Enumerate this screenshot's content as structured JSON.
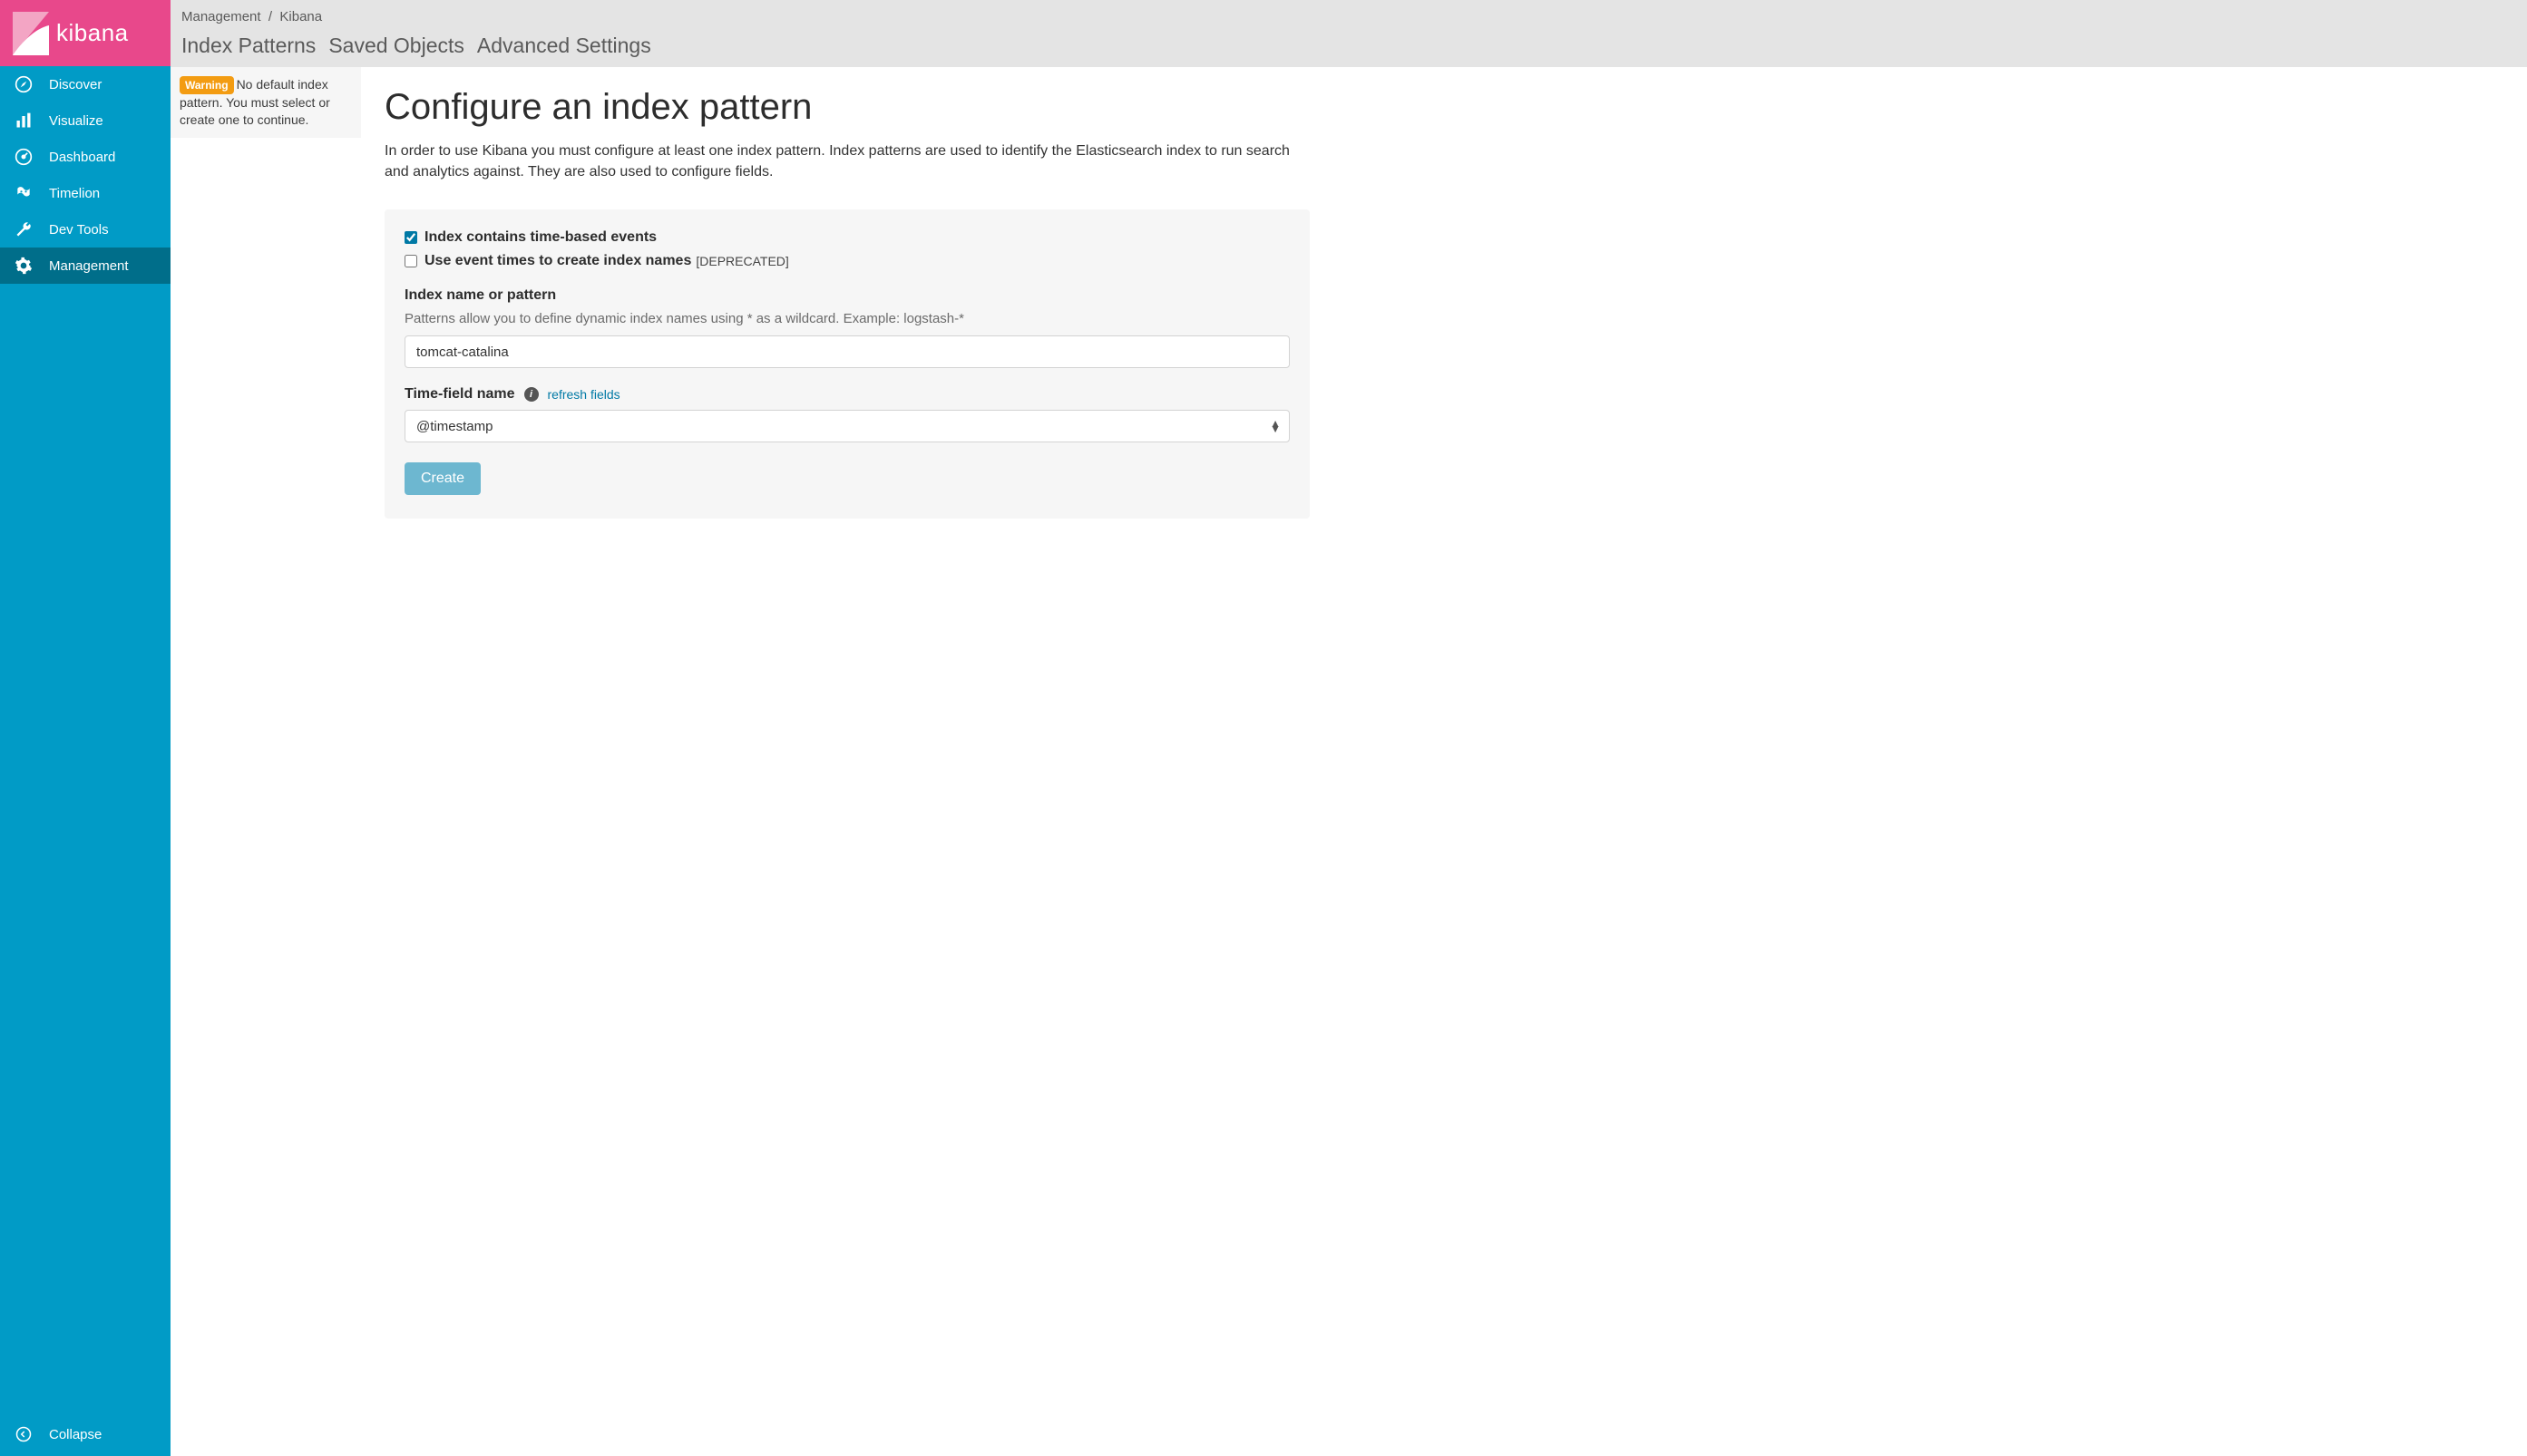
{
  "brand": "kibana",
  "sidebar": {
    "items": [
      {
        "label": "Discover"
      },
      {
        "label": "Visualize"
      },
      {
        "label": "Dashboard"
      },
      {
        "label": "Timelion"
      },
      {
        "label": "Dev Tools"
      },
      {
        "label": "Management"
      }
    ],
    "collapse": "Collapse"
  },
  "breadcrumb": {
    "root": "Management",
    "sep": "/",
    "current": "Kibana"
  },
  "tabs": [
    {
      "label": "Index Patterns"
    },
    {
      "label": "Saved Objects"
    },
    {
      "label": "Advanced Settings"
    }
  ],
  "warning": {
    "badge": "Warning",
    "text": "No default index pattern. You must select or create one to continue."
  },
  "page": {
    "title": "Configure an index pattern",
    "description": "In order to use Kibana you must configure at least one index pattern. Index patterns are used to identify the Elasticsearch index to run search and analytics against. They are also used to configure fields."
  },
  "form": {
    "timeBased": {
      "label": "Index contains time-based events",
      "checked": true
    },
    "eventTimes": {
      "label": "Use event times to create index names",
      "deprecated": "[DEPRECATED]",
      "checked": false
    },
    "indexName": {
      "label": "Index name or pattern",
      "help": "Patterns allow you to define dynamic index names using * as a wildcard. Example: logstash-*",
      "value": "tomcat-catalina"
    },
    "timeField": {
      "label": "Time-field name",
      "refresh": "refresh fields",
      "selected": "@timestamp"
    },
    "createButton": "Create"
  }
}
